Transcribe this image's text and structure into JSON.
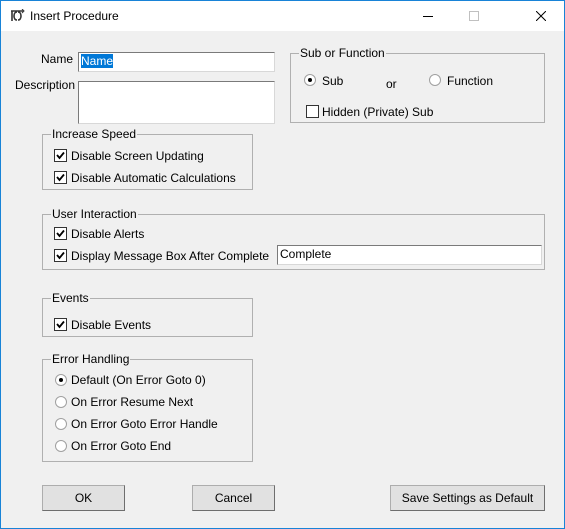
{
  "window": {
    "title": "Insert Procedure",
    "icon": "vba-procedure-icon",
    "controls": {
      "minimize": "minimize-icon",
      "maximize": "maximize-icon",
      "close": "close-icon"
    }
  },
  "name_field": {
    "label": "Name",
    "value": "Name"
  },
  "description_field": {
    "label": "Description",
    "value": ""
  },
  "sub_or_function": {
    "title": "Sub or Function",
    "options": [
      {
        "label": "Sub",
        "selected": true
      },
      {
        "label": "Function",
        "selected": false
      }
    ],
    "or_label": "or",
    "hidden_sub": {
      "label": "Hidden (Private) Sub",
      "checked": false
    }
  },
  "increase_speed": {
    "title": "Increase Speed",
    "items": [
      {
        "label": "Disable Screen Updating",
        "checked": true
      },
      {
        "label": "Disable Automatic Calculations",
        "checked": true
      }
    ]
  },
  "user_interaction": {
    "title": "User Interaction",
    "items": [
      {
        "label": "Disable Alerts",
        "checked": true
      },
      {
        "label": "Display Message Box After Complete",
        "checked": true
      }
    ],
    "message_value": "Complete"
  },
  "events": {
    "title": "Events",
    "items": [
      {
        "label": "Disable Events",
        "checked": true
      }
    ]
  },
  "error_handling": {
    "title": "Error Handling",
    "options": [
      {
        "label": "Default (On Error Goto 0)",
        "selected": true
      },
      {
        "label": "On Error Resume Next",
        "selected": false
      },
      {
        "label": "On Error Goto Error Handle",
        "selected": false
      },
      {
        "label": "On Error Goto End",
        "selected": false
      }
    ]
  },
  "buttons": {
    "ok": "OK",
    "cancel": "Cancel",
    "save_default": "Save Settings as Default"
  }
}
